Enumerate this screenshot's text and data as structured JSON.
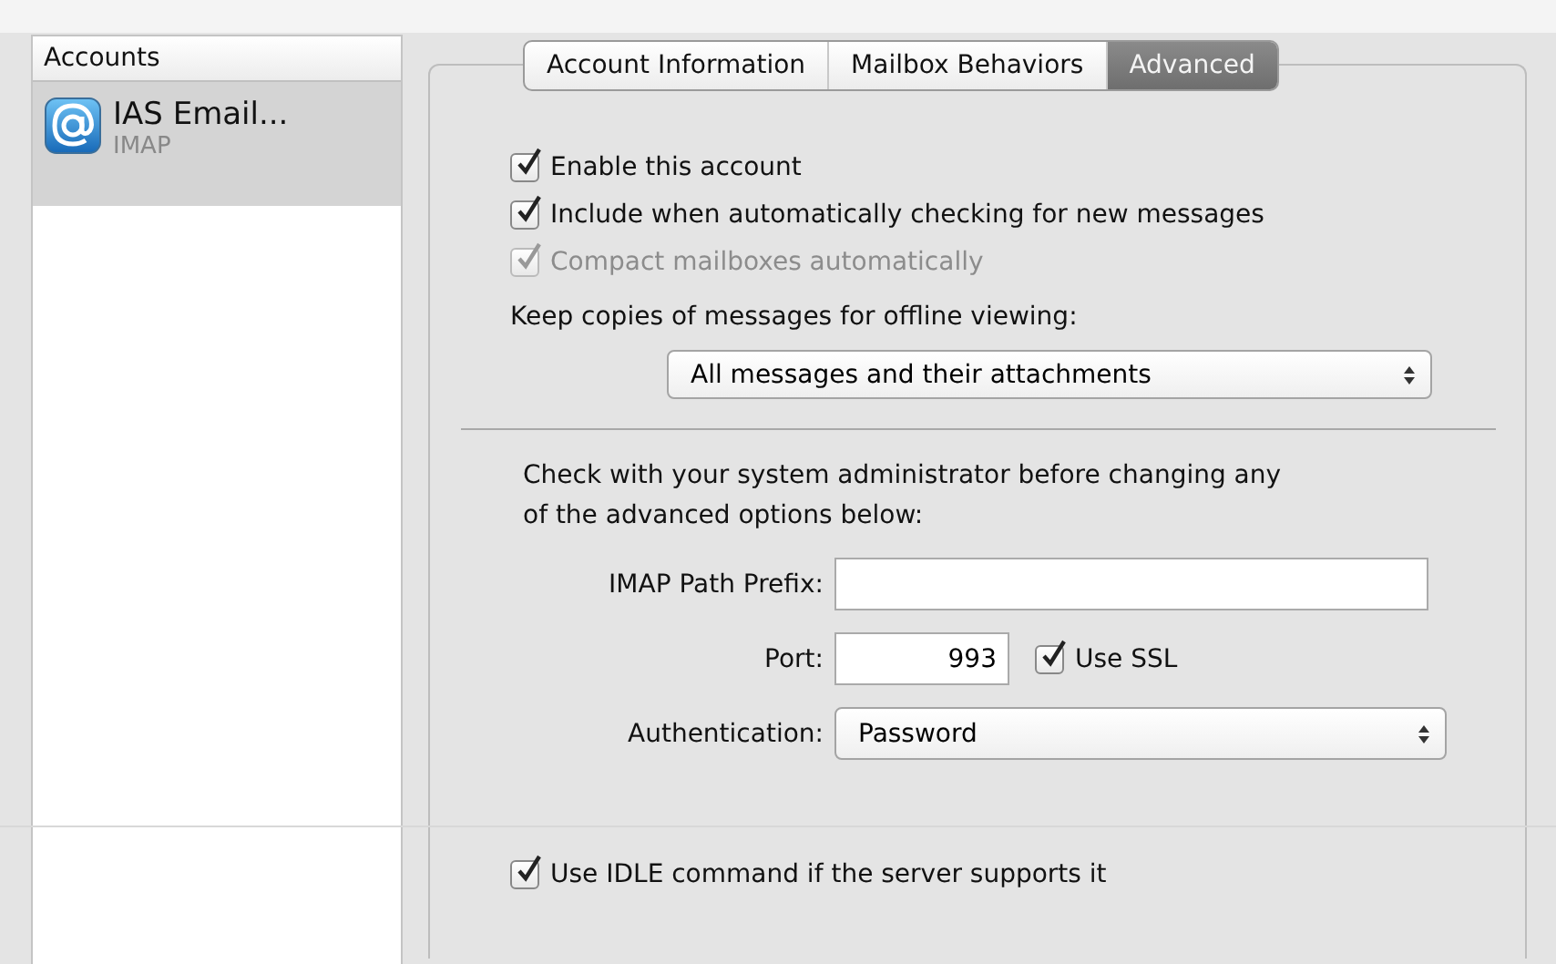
{
  "sidebar": {
    "header": "Accounts",
    "accounts": [
      {
        "name": "IAS Email...",
        "type": "IMAP",
        "selected": true
      }
    ]
  },
  "tabs": [
    {
      "label": "Account Information",
      "selected": false
    },
    {
      "label": "Mailbox Behaviors",
      "selected": false
    },
    {
      "label": "Advanced",
      "selected": true
    }
  ],
  "options": [
    {
      "label": "Enable this account",
      "checked": true,
      "disabled": false
    },
    {
      "label": "Include when automatically checking for new messages",
      "checked": true,
      "disabled": false
    },
    {
      "label": "Compact mailboxes automatically",
      "checked": true,
      "disabled": true
    }
  ],
  "offline": {
    "label": "Keep copies of messages for offline viewing:",
    "value": "All messages and their attachments"
  },
  "note": "Check with your system administrator before changing any of the advanced options below:",
  "path_prefix": {
    "label": "IMAP Path Prefix:"
  },
  "port": {
    "label": "Port:",
    "value": "993",
    "ssl": {
      "label": "Use SSL",
      "checked": true
    }
  },
  "authentication": {
    "label": "Authentication:",
    "value": "Password"
  },
  "idle": {
    "label": "Use IDLE command if the server supports it",
    "checked": true
  }
}
